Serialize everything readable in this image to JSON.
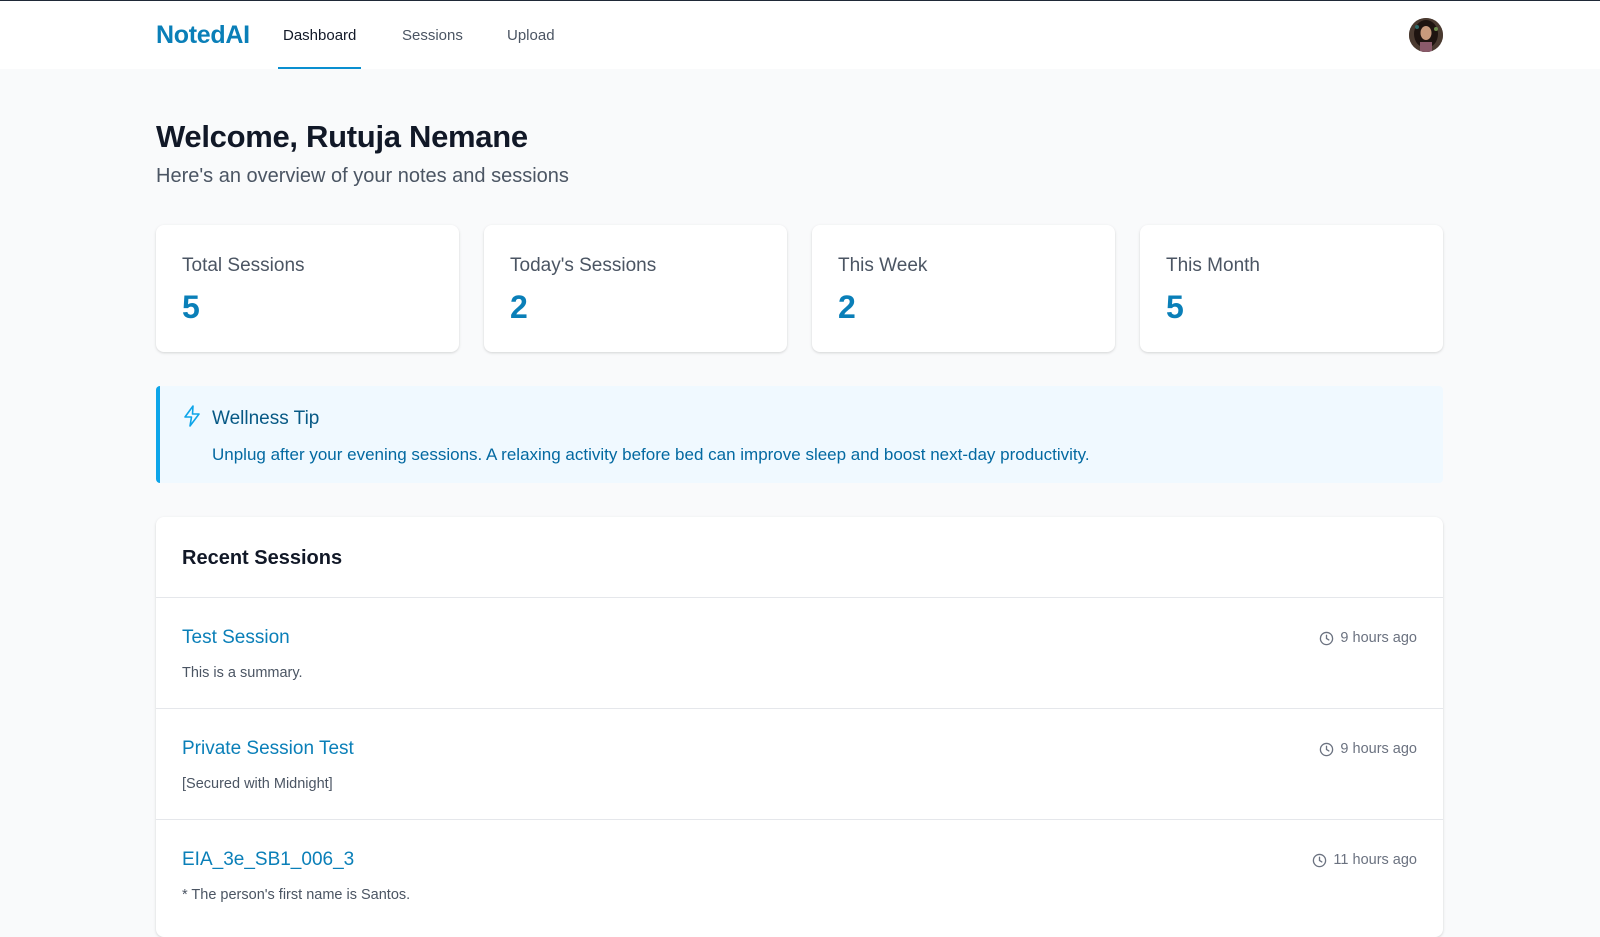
{
  "app": {
    "brand": "NotedAI"
  },
  "nav": {
    "tabs": [
      {
        "label": "Dashboard",
        "active": true
      },
      {
        "label": "Sessions",
        "active": false
      },
      {
        "label": "Upload",
        "active": false
      }
    ]
  },
  "welcome": {
    "title": "Welcome, Rutuja Nemane",
    "subtitle": "Here's an overview of your notes and sessions"
  },
  "stats": [
    {
      "label": "Total Sessions",
      "value": "5"
    },
    {
      "label": "Today's Sessions",
      "value": "2"
    },
    {
      "label": "This Week",
      "value": "2"
    },
    {
      "label": "This Month",
      "value": "5"
    }
  ],
  "tip": {
    "icon": "lightning-icon",
    "title": "Wellness Tip",
    "text": "Unplug after your evening sessions. A relaxing activity before bed can improve sleep and boost next-day productivity."
  },
  "recent": {
    "title": "Recent Sessions",
    "sessions": [
      {
        "title": "Test Session",
        "summary": "This is a summary.",
        "time": "9 hours ago"
      },
      {
        "title": "Private Session Test",
        "summary": "[Secured with Midnight]",
        "time": "9 hours ago"
      },
      {
        "title": "EIA_3e_SB1_006_3",
        "summary": "* The person's first name is Santos.",
        "time": "11 hours ago"
      }
    ]
  },
  "colors": {
    "brand": "#0a7fb8",
    "accent": "#0ea5e9",
    "tip_background": "#f0f9ff",
    "page_background": "#f9fafb"
  }
}
